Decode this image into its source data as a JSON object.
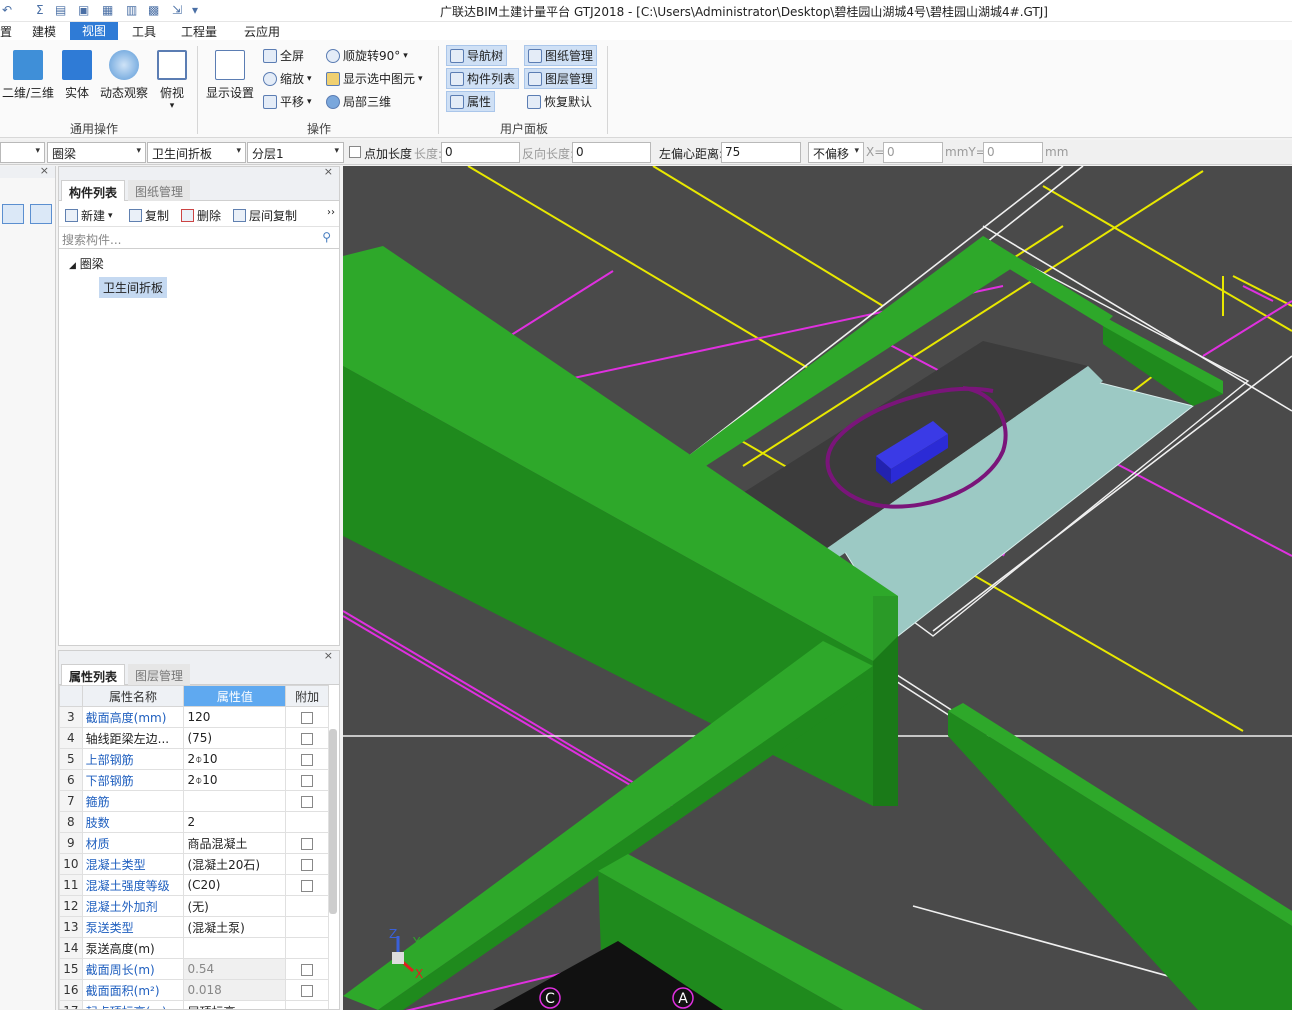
{
  "window": {
    "title": "广联达BIM土建计量平台 GTJ2018 - [C:\\Users\\Administrator\\Desktop\\碧桂园山湖城4号\\碧桂园山湖城4#.GTJ]"
  },
  "menu": {
    "items": [
      "建模",
      "视图",
      "工具",
      "工程量",
      "云应用"
    ],
    "partial": "置",
    "active": "视图"
  },
  "ribbon": {
    "general": {
      "label": "通用操作",
      "buttons": [
        "二维/三维",
        "实体",
        "动态观察",
        "俯视"
      ]
    },
    "operation": {
      "label": "操作",
      "display_settings": "显示设置",
      "fullscreen": "全屏",
      "zoom": "缩放",
      "pan": "平移",
      "rotate": "顺旋转90°",
      "show_selected": "显示选中图元",
      "local_3d": "局部三维"
    },
    "user_panel": {
      "label": "用户面板",
      "nav_tree": "导航树",
      "component_list": "构件列表",
      "properties": "属性",
      "drawing_mgmt": "图纸管理",
      "layer_mgmt": "图层管理",
      "restore_default": "恢复默认"
    }
  },
  "propbar": {
    "combo1": "",
    "type": "圈梁",
    "name": "卫生间折板",
    "layer": "分层1",
    "point_length_label": "点加长度",
    "length_label": "长度:",
    "length_value": "0",
    "reverse_length_label": "反向长度:",
    "reverse_length_value": "0",
    "left_offset_label": "左偏心距离:",
    "left_offset_value": "75",
    "offset_mode": "不偏移",
    "x_label": "X=",
    "x_value": "0",
    "mm_y_label": "mmY=",
    "y_value": "0",
    "mm_label": "mm"
  },
  "component_panel": {
    "tabs": [
      "构件列表",
      "图纸管理"
    ],
    "toolbar": {
      "new": "新建",
      "copy": "复制",
      "delete": "删除",
      "floor_copy": "层间复制"
    },
    "search_placeholder": "搜索构件...",
    "tree": {
      "root": "圈梁",
      "child": "卫生间折板"
    }
  },
  "properties_panel": {
    "tabs": [
      "属性列表",
      "图层管理"
    ],
    "headers": [
      "属性名称",
      "属性值",
      "附加"
    ],
    "rows": [
      {
        "n": "3",
        "name": "截面高度(mm)",
        "value": "120",
        "blue": true,
        "check": true,
        "grey": false
      },
      {
        "n": "4",
        "name": "轴线距梁左边...",
        "value": "(75)",
        "blue": false,
        "check": true,
        "grey": false
      },
      {
        "n": "5",
        "name": "上部钢筋",
        "value": "2⌽10",
        "blue": true,
        "check": true,
        "grey": false
      },
      {
        "n": "6",
        "name": "下部钢筋",
        "value": "2⌽10",
        "blue": true,
        "check": true,
        "grey": false
      },
      {
        "n": "7",
        "name": "箍筋",
        "value": "",
        "blue": true,
        "check": true,
        "grey": false
      },
      {
        "n": "8",
        "name": "肢数",
        "value": "2",
        "blue": true,
        "check": false,
        "grey": false
      },
      {
        "n": "9",
        "name": "材质",
        "value": "商品混凝土",
        "blue": true,
        "check": true,
        "grey": false
      },
      {
        "n": "10",
        "name": "混凝土类型",
        "value": "(混凝土20石)",
        "blue": true,
        "check": true,
        "grey": false
      },
      {
        "n": "11",
        "name": "混凝土强度等级",
        "value": "(C20)",
        "blue": true,
        "check": true,
        "grey": false
      },
      {
        "n": "12",
        "name": "混凝土外加剂",
        "value": "(无)",
        "blue": true,
        "check": false,
        "grey": false
      },
      {
        "n": "13",
        "name": "泵送类型",
        "value": "(混凝土泵)",
        "blue": true,
        "check": false,
        "grey": false
      },
      {
        "n": "14",
        "name": "泵送高度(m)",
        "value": "",
        "blue": false,
        "check": false,
        "grey": false
      },
      {
        "n": "15",
        "name": "截面周长(m)",
        "value": "0.54",
        "blue": true,
        "check": true,
        "grey": true
      },
      {
        "n": "16",
        "name": "截面面积(m²)",
        "value": "0.018",
        "blue": true,
        "check": true,
        "grey": true
      },
      {
        "n": "17",
        "name": "起点顶标高(m)",
        "value": "层顶标高",
        "blue": true,
        "check": false,
        "grey": false
      }
    ]
  },
  "viewport": {
    "axis_labels": [
      "Z",
      "Y",
      "X"
    ],
    "grid_labels": [
      "C",
      "A"
    ],
    "colors": {
      "background": "#4a4a4a",
      "beam": "#2ea82a",
      "slab": "#9cc9c4",
      "selected": "#2b2bd6",
      "annotation": "#7a157a",
      "axis_line_yellow": "#e8e800",
      "axis_line_magenta": "#e030e0"
    }
  }
}
